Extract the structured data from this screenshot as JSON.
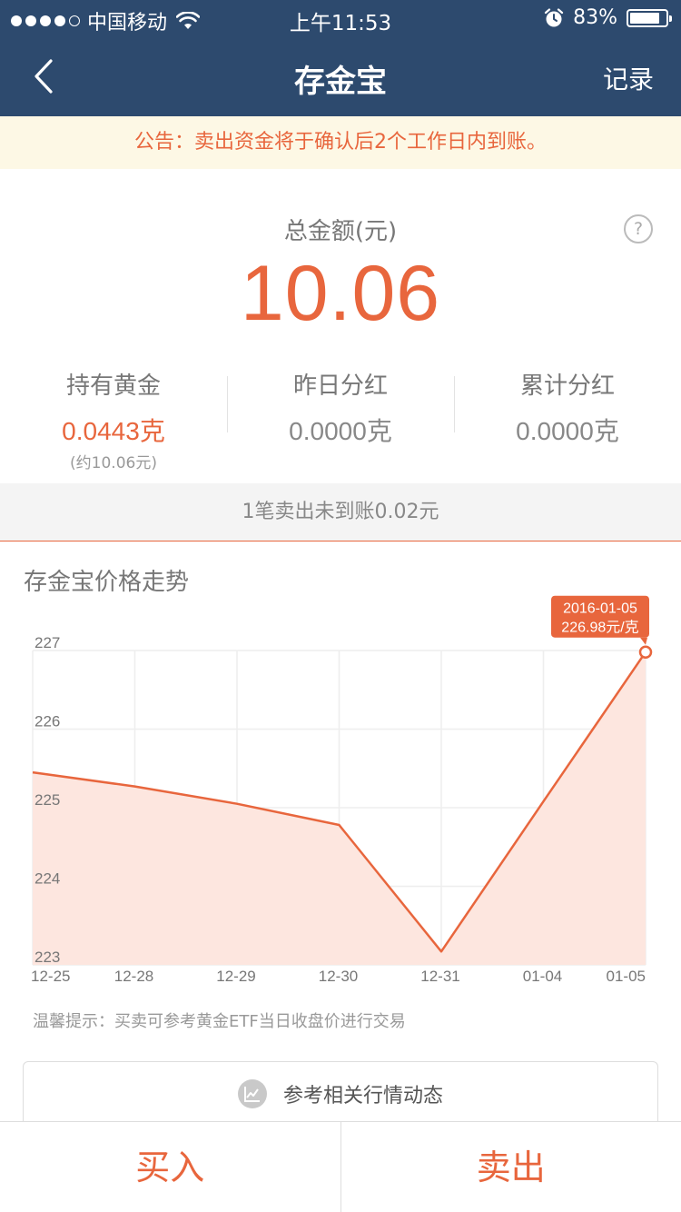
{
  "status_bar": {
    "carrier": "中国移动",
    "time": "上午11:53",
    "battery": "83%",
    "battery_level": 0.83
  },
  "nav": {
    "title": "存金宝",
    "record": "记录"
  },
  "notice": "公告：卖出资金将于确认后2个工作日内到账。",
  "summary": {
    "total_label": "总金额(元)",
    "help": "?",
    "total_value": "10.06",
    "stats": [
      {
        "label": "持有黄金",
        "value": "0.0443克",
        "sub": "(约10.06元)"
      },
      {
        "label": "昨日分红",
        "value": "0.0000克"
      },
      {
        "label": "累计分红",
        "value": "0.0000克"
      }
    ]
  },
  "pending": "1笔卖出未到账0.02元",
  "chart_title": "存金宝价格走势",
  "chart_data": {
    "type": "area",
    "x": [
      "12-25",
      "12-28",
      "12-29",
      "12-30",
      "12-31",
      "01-04",
      "01-05"
    ],
    "values": [
      225.45,
      225.27,
      225.05,
      224.78,
      223.17,
      225.08,
      226.98
    ],
    "ylim": [
      223,
      227
    ],
    "yticks": [
      223,
      224,
      225,
      226,
      227
    ],
    "grid": true,
    "colors": {
      "line": "#e8663d",
      "fill": "#fde6df",
      "grid": "#eeeeee"
    },
    "annotation": {
      "date": "2016-01-05",
      "price": "226.98元/克"
    }
  },
  "tip_note": "温馨提示：买卖可参考黄金ETF当日收盘价进行交易",
  "related": {
    "icon": "trend-chart-icon",
    "label": "参考相关行情动态"
  },
  "bottom": {
    "buy": "买入",
    "sell": "卖出"
  },
  "colors": {
    "nav_bg": "#2d4a6e",
    "accent": "#e8663d",
    "notice_bg": "#fdf8e5"
  }
}
